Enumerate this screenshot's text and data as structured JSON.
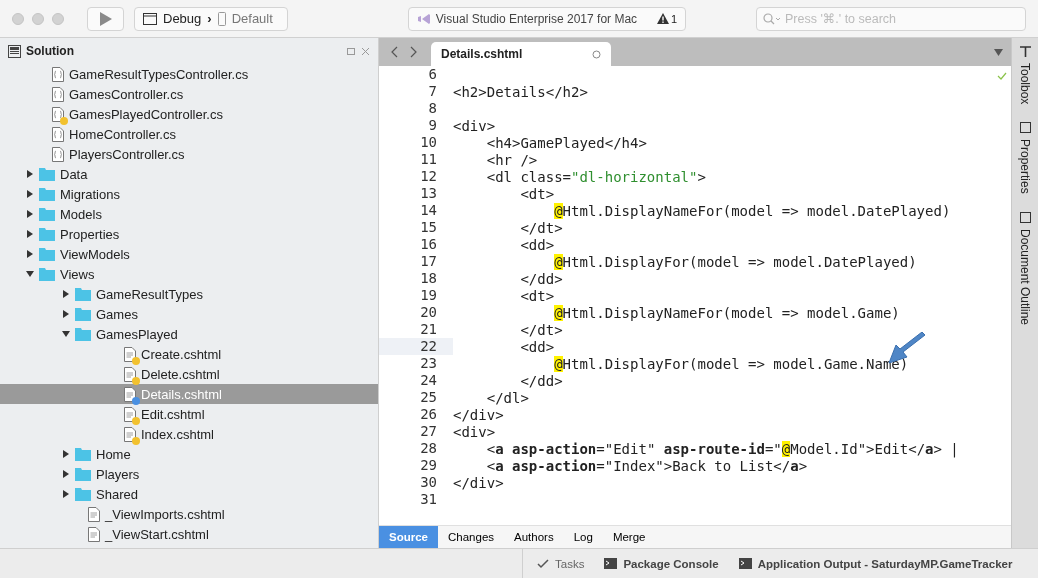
{
  "toolbar": {
    "configuration": "Debug",
    "separator": "›",
    "device": "Default",
    "status_text": "Visual Studio Enterprise 2017 for Mac",
    "warning_count": "1",
    "search": {
      "placeholder": "Press '⌘.' to search"
    }
  },
  "solution_pad": {
    "title": "Solution",
    "tree": [
      {
        "label": "GameResultTypesController.cs",
        "kind": "cs",
        "selected": false
      },
      {
        "label": "GamesController.cs",
        "kind": "cs",
        "selected": false
      },
      {
        "label": "GamesPlayedController.cs",
        "kind": "cs",
        "color": "#f2c12e",
        "selected": false
      },
      {
        "label": "HomeController.cs",
        "kind": "cs",
        "selected": false
      },
      {
        "label": "PlayersController.cs",
        "kind": "cs",
        "selected": false
      },
      {
        "label": "Data",
        "kind": "folder",
        "expanded": false,
        "selected": false
      },
      {
        "label": "Migrations",
        "kind": "folder",
        "expanded": false,
        "selected": false
      },
      {
        "label": "Models",
        "kind": "folder",
        "expanded": false,
        "selected": false
      },
      {
        "label": "Properties",
        "kind": "folder",
        "expanded": false,
        "selected": false
      },
      {
        "label": "ViewModels",
        "kind": "folder",
        "expanded": false,
        "selected": false
      },
      {
        "label": "Views",
        "kind": "folder",
        "expanded": true,
        "selected": false,
        "children": [
          {
            "label": "GameResultTypes",
            "kind": "folder",
            "expanded": false,
            "selected": false
          },
          {
            "label": "Games",
            "kind": "folder",
            "expanded": false,
            "selected": false
          },
          {
            "label": "GamesPlayed",
            "kind": "folder",
            "expanded": true,
            "selected": false,
            "children": [
              {
                "label": "Create.cshtml",
                "kind": "cshtml",
                "color": "#f2c12e",
                "selected": false
              },
              {
                "label": "Delete.cshtml",
                "kind": "cshtml",
                "color": "#f2c12e",
                "selected": false
              },
              {
                "label": "Details.cshtml",
                "kind": "cshtml",
                "color": "#4a90e2",
                "selected": true
              },
              {
                "label": "Edit.cshtml",
                "kind": "cshtml",
                "color": "#f2c12e",
                "selected": false
              },
              {
                "label": "Index.cshtml",
                "kind": "cshtml",
                "color": "#f2c12e",
                "selected": false
              }
            ]
          },
          {
            "label": "Home",
            "kind": "folder",
            "expanded": false,
            "selected": false
          },
          {
            "label": "Players",
            "kind": "folder",
            "expanded": false,
            "selected": false
          },
          {
            "label": "Shared",
            "kind": "folder",
            "expanded": false,
            "selected": false
          },
          {
            "label": "_ViewImports.cshtml",
            "kind": "cshtml",
            "selected": false
          },
          {
            "label": "_ViewStart.cshtml",
            "kind": "cshtml",
            "selected": false
          }
        ]
      }
    ]
  },
  "editor": {
    "tab": "Details.cshtml",
    "lines": [
      {
        "number": "6",
        "current": false
      },
      {
        "number": "7",
        "current": false,
        "code": [
          {
            "text": "<h2>Details</h2>",
            "kind": "plain"
          }
        ]
      },
      {
        "number": "8",
        "current": false
      },
      {
        "number": "9",
        "current": false,
        "code": [
          {
            "text": "<div>",
            "kind": "plain"
          }
        ]
      },
      {
        "number": "10",
        "current": false,
        "code": [
          {
            "text": "    <h4>GamePlayed</h4>",
            "kind": "plain"
          }
        ]
      },
      {
        "number": "11",
        "current": false,
        "code": [
          {
            "text": "    <hr />",
            "kind": "plain"
          }
        ]
      },
      {
        "number": "12",
        "current": false,
        "code": [
          {
            "text": "    <dl class=",
            "kind": "plain"
          },
          {
            "text": "\"dl-horizontal\"",
            "kind": "string"
          },
          {
            "text": ">",
            "kind": "plain"
          }
        ]
      },
      {
        "number": "13",
        "current": false,
        "code": [
          {
            "text": "        <dt>",
            "kind": "plain"
          }
        ]
      },
      {
        "number": "14",
        "current": false,
        "code": [
          {
            "text": "            @",
            "kind": "razor"
          },
          {
            "text": "Html.DisplayNameFor(model => model.DatePlayed)",
            "kind": "plain"
          }
        ]
      },
      {
        "number": "15",
        "current": false,
        "code": [
          {
            "text": "        </dt>",
            "kind": "plain"
          }
        ]
      },
      {
        "number": "16",
        "current": false,
        "code": [
          {
            "text": "        <dd>",
            "kind": "plain"
          }
        ]
      },
      {
        "number": "17",
        "current": false,
        "code": [
          {
            "text": "            @",
            "kind": "razor"
          },
          {
            "text": "Html.DisplayFor(model => model.DatePlayed)",
            "kind": "plain"
          }
        ]
      },
      {
        "number": "18",
        "current": false,
        "code": [
          {
            "text": "        </dd>",
            "kind": "plain"
          }
        ]
      },
      {
        "number": "19",
        "current": false,
        "code": [
          {
            "text": "        <dt>",
            "kind": "plain"
          }
        ]
      },
      {
        "number": "20",
        "current": false,
        "code": [
          {
            "text": "            @",
            "kind": "razor"
          },
          {
            "text": "Html.DisplayNameFor(model => model.Game)",
            "kind": "plain"
          }
        ]
      },
      {
        "number": "21",
        "current": false,
        "code": [
          {
            "text": "        </dt>",
            "kind": "plain"
          }
        ]
      },
      {
        "number": "22",
        "current": true,
        "code": [
          {
            "text": "        <dd>",
            "kind": "plain"
          }
        ]
      },
      {
        "number": "23",
        "current": false,
        "code": [
          {
            "text": "            @",
            "kind": "razor"
          },
          {
            "text": "Html.DisplayFor(model => model.Game.Name)",
            "kind": "plain"
          }
        ]
      },
      {
        "number": "24",
        "current": false,
        "code": [
          {
            "text": "        </dd>",
            "kind": "plain"
          }
        ]
      },
      {
        "number": "25",
        "current": false,
        "code": [
          {
            "text": "    </dl>",
            "kind": "plain"
          }
        ]
      },
      {
        "number": "26",
        "current": false,
        "code": [
          {
            "text": "</div>",
            "kind": "plain"
          }
        ]
      },
      {
        "number": "27",
        "current": false,
        "code": [
          {
            "text": "<div>",
            "kind": "plain"
          }
        ]
      },
      {
        "number": "28",
        "current": false,
        "code": [
          {
            "text": "    <",
            "kind": "plain"
          },
          {
            "text": "a asp-action",
            "kind": "bold"
          },
          {
            "text": "=\"Edit\" ",
            "kind": "plain"
          },
          {
            "text": "asp-route-id",
            "kind": "bold"
          },
          {
            "text": "=\"",
            "kind": "plain"
          },
          {
            "text": "@",
            "kind": "razor"
          },
          {
            "text": "Model.Id\">Edit</",
            "kind": "plain"
          },
          {
            "text": "a",
            "kind": "bold"
          },
          {
            "text": "> |",
            "kind": "plain"
          }
        ]
      },
      {
        "number": "29",
        "current": false,
        "code": [
          {
            "text": "    <",
            "kind": "plain"
          },
          {
            "text": "a asp-action",
            "kind": "bold"
          },
          {
            "text": "=\"Index\">Back to List</",
            "kind": "plain"
          },
          {
            "text": "a",
            "kind": "bold"
          },
          {
            "text": ">",
            "kind": "plain"
          }
        ]
      },
      {
        "number": "30",
        "current": false,
        "code": [
          {
            "text": "</div>",
            "kind": "plain"
          }
        ]
      },
      {
        "number": "31",
        "current": false
      }
    ],
    "bottom_tabs": [
      {
        "label": "Source",
        "selected": true
      },
      {
        "label": "Changes",
        "selected": false
      },
      {
        "label": "Authors",
        "selected": false
      },
      {
        "label": "Log",
        "selected": false
      },
      {
        "label": "Merge",
        "selected": false
      }
    ]
  },
  "right_pads": [
    "Toolbox",
    "Properties",
    "Document Outline"
  ],
  "status_bar": [
    {
      "label": "Tasks",
      "kind": "tasks"
    },
    {
      "label": "Package Console",
      "kind": "console"
    },
    {
      "label": "Application Output - SaturdayMP.GameTracker",
      "kind": "console"
    }
  ]
}
